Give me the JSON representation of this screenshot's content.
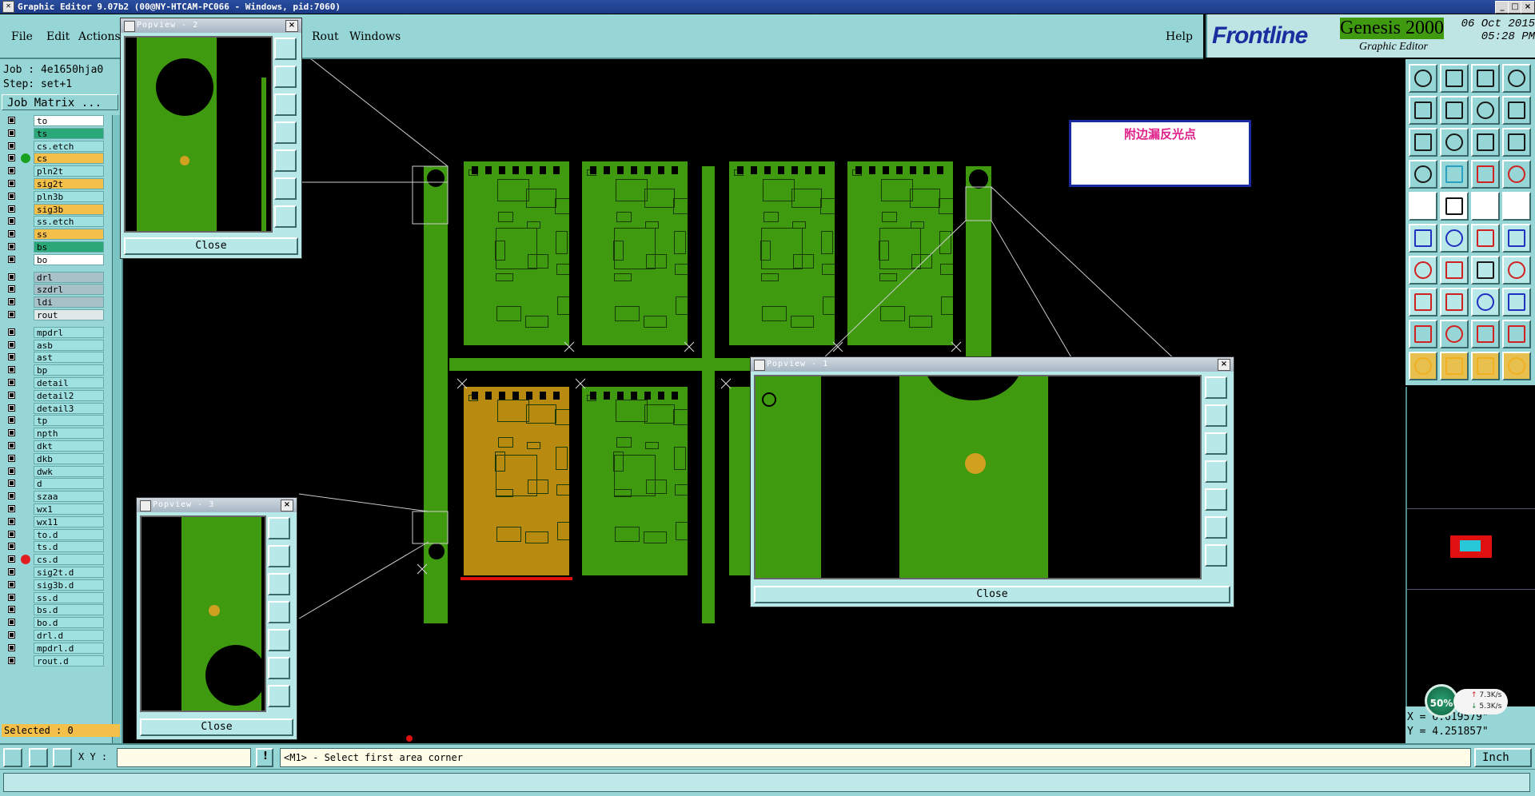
{
  "window": {
    "title": "Graphic Editor 9.07b2 (00@NY-HTCAM-PC066 - Windows, pid:7060)"
  },
  "menu": {
    "file": "File",
    "edit": "Edit",
    "actions": "Actions",
    "rout": "Rout",
    "windows": "Windows",
    "help": "Help"
  },
  "brand": {
    "logo": "Frontline",
    "product": "Genesis 2000",
    "subtitle": "Graphic Editor",
    "date": "06 Oct 2015",
    "time": "05:28 PM"
  },
  "job": {
    "job_label": "Job : 4e1650hja0",
    "step_label": "Step: set+1",
    "job_matrix": "Job Matrix ..."
  },
  "layers": [
    {
      "name": "to",
      "bg": "#ffffff"
    },
    {
      "name": "ts",
      "bg": "#2aa878"
    },
    {
      "name": "cs.etch",
      "bg": "#9fe0e0"
    },
    {
      "name": "cs",
      "bg": "#f5c04a",
      "dot": "#1aa020"
    },
    {
      "name": "pln2t",
      "bg": "#9fe0e0"
    },
    {
      "name": "sig2t",
      "bg": "#f5c04a"
    },
    {
      "name": "pln3b",
      "bg": "#9fe0e0"
    },
    {
      "name": "sig3b",
      "bg": "#f5c04a"
    },
    {
      "name": "ss.etch",
      "bg": "#9fe0e0"
    },
    {
      "name": "ss",
      "bg": "#f5c04a"
    },
    {
      "name": "bs",
      "bg": "#2aa878"
    },
    {
      "name": "bo",
      "bg": "#ffffff"
    },
    {
      "name": "drl",
      "bg": "#a8c0c8"
    },
    {
      "name": "szdrl",
      "bg": "#a8c0c8"
    },
    {
      "name": "ldi",
      "bg": "#a8c0c8"
    },
    {
      "name": "rout",
      "bg": "#e0e8e8"
    },
    {
      "name": "mpdrl",
      "bg": "#9fe0e0"
    },
    {
      "name": "asb",
      "bg": "#9fe0e0"
    },
    {
      "name": "ast",
      "bg": "#9fe0e0"
    },
    {
      "name": "bp",
      "bg": "#9fe0e0"
    },
    {
      "name": "detail",
      "bg": "#9fe0e0"
    },
    {
      "name": "detail2",
      "bg": "#9fe0e0"
    },
    {
      "name": "detail3",
      "bg": "#9fe0e0"
    },
    {
      "name": "tp",
      "bg": "#9fe0e0"
    },
    {
      "name": "npth",
      "bg": "#9fe0e0"
    },
    {
      "name": "dkt",
      "bg": "#9fe0e0"
    },
    {
      "name": "dkb",
      "bg": "#9fe0e0"
    },
    {
      "name": "dwk",
      "bg": "#9fe0e0"
    },
    {
      "name": "d",
      "bg": "#9fe0e0"
    },
    {
      "name": "szaa",
      "bg": "#9fe0e0"
    },
    {
      "name": "wx1",
      "bg": "#9fe0e0"
    },
    {
      "name": "wx11",
      "bg": "#9fe0e0"
    },
    {
      "name": "to.d",
      "bg": "#9fe0e0"
    },
    {
      "name": "ts.d",
      "bg": "#9fe0e0"
    },
    {
      "name": "cs.d",
      "bg": "#9fe0e0",
      "dot": "#e02020"
    },
    {
      "name": "sig2t.d",
      "bg": "#9fe0e0"
    },
    {
      "name": "sig3b.d",
      "bg": "#9fe0e0"
    },
    {
      "name": "ss.d",
      "bg": "#9fe0e0"
    },
    {
      "name": "bs.d",
      "bg": "#9fe0e0"
    },
    {
      "name": "bo.d",
      "bg": "#9fe0e0"
    },
    {
      "name": "drl.d",
      "bg": "#9fe0e0"
    },
    {
      "name": "mpdrl.d",
      "bg": "#9fe0e0"
    },
    {
      "name": "rout.d",
      "bg": "#9fe0e0"
    }
  ],
  "selected": "Selected : 0",
  "popviews": {
    "p1_title": "Popview - 1",
    "p2_title": "Popview - 2",
    "p3_title": "Popview - 3",
    "close": "Close"
  },
  "note": "附边漏反光点",
  "command": {
    "xy_label": "X Y :",
    "message": "<M1> - Select first area corner",
    "unit": "Inch"
  },
  "coords": {
    "x": "X = 6.619579\"",
    "y": "Y = 4.251857\""
  },
  "network": {
    "percent": "50%",
    "up": "7.3K/s",
    "down": "5.3K/s"
  },
  "colors": {
    "panel": "#97d6d6",
    "board_green": "#3f9a10",
    "board_gold": "#b88a10",
    "pad": "#d0a020"
  }
}
